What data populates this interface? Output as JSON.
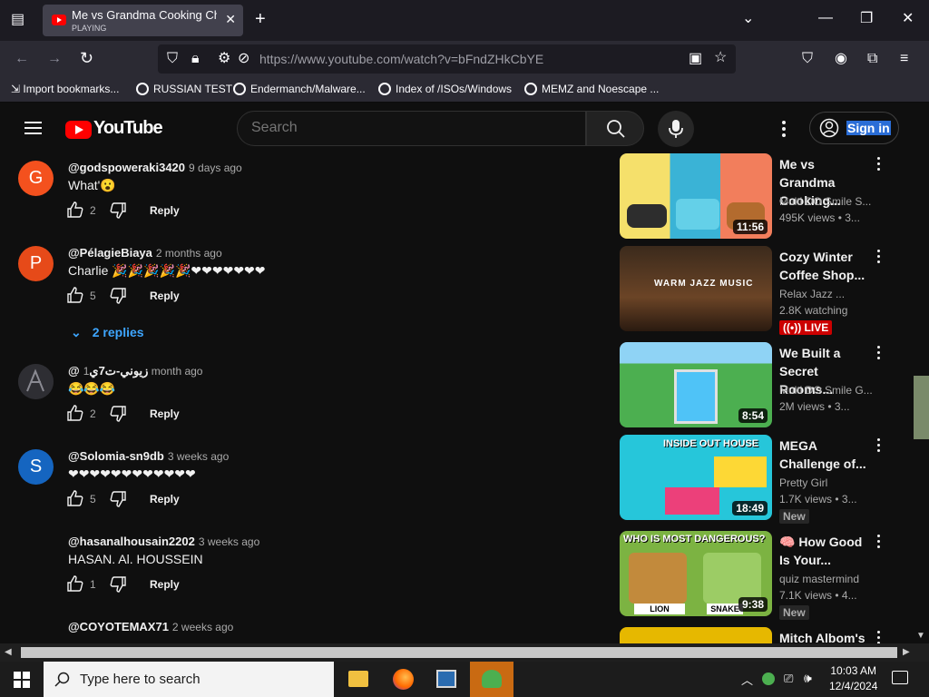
{
  "browser": {
    "tab_title": "Me vs Grandma Cooking Challenge",
    "tab_status": "PLAYING",
    "url": "https://www.youtube.com/watch?v=bFndZHkCbYE",
    "bookmarks": [
      "Import bookmarks...",
      "RUSSIAN TEST",
      "Endermanch/Malware...",
      "Index of /ISOs/Windows",
      "MEMZ and Noescape ..."
    ]
  },
  "youtube": {
    "logo": "YouTube",
    "search_placeholder": "Search",
    "sign_in": "Sign in"
  },
  "comments": [
    {
      "initial": "G",
      "color": "#f4511e",
      "author": "@godspoweraki3420",
      "time": "9 days ago",
      "text": "What'😮",
      "likes": "2",
      "reply": "Reply"
    },
    {
      "initial": "P",
      "color": "#e64a19",
      "author": "@PélagieBiaya",
      "time": "2 months ago",
      "text": "Charlie 🎉🎉🎉🎉🎉❤❤❤❤❤❤❤",
      "likes": "5",
      "reply": "Reply"
    },
    {
      "initial": "",
      "color": "#3a3a3a",
      "author": "@زيوني-ت7ي",
      "time": "1 month ago",
      "text": "😂😂😂",
      "likes": "2",
      "reply": "Reply"
    },
    {
      "initial": "S",
      "color": "#1565c0",
      "author": "@Solomia-sn9db",
      "time": "3 weeks ago",
      "text": "❤❤❤❤❤❤❤❤❤❤❤❤",
      "likes": "5",
      "reply": "Reply"
    },
    {
      "initial": "",
      "color": "",
      "author": "@hasanalhousain2202",
      "time": "3 weeks ago",
      "text": "HASAN.  Al.  HOUSSEIN",
      "likes": "1",
      "reply": "Reply"
    },
    {
      "initial": "",
      "color": "",
      "author": "@COYOTEMAX71",
      "time": "2 weeks ago",
      "text": "",
      "likes": "",
      "reply": ""
    }
  ],
  "replies_toggle": "2 replies",
  "videos": [
    {
      "title": "Me vs Grandma Cooking...",
      "channel": "Multi DO Smile S...",
      "meta": "495K views • 3...",
      "duration": "11:56",
      "badge": "",
      "thumb_color": "#3ab3d6"
    },
    {
      "title": "Cozy Winter Coffee Shop...",
      "channel": "Relax Jazz ...",
      "meta": "2.8K watching",
      "duration": "",
      "badge": "LIVE",
      "thumb_color": "#3b2a1c",
      "thumb_text": "WARM JAZZ MUSIC"
    },
    {
      "title": "We Built a Secret Rooms...",
      "channel": "Multi DO Smile G...",
      "meta": "2M views • 3...",
      "duration": "8:54",
      "badge": "",
      "thumb_color": "#4caf50"
    },
    {
      "title": "MEGA Challenge of...",
      "channel": "Pretty Girl",
      "meta": "1.7K views • 3...",
      "duration": "18:49",
      "badge": "New",
      "thumb_color": "#26c6da",
      "thumb_text": "INSIDE OUT HOUSE"
    },
    {
      "title": "🧠 How Good Is Your...",
      "channel": "quiz mastermind",
      "meta": "7.1K views • 4...",
      "duration": "9:38",
      "badge": "New",
      "thumb_color": "#7cb342",
      "thumb_text": "WHO IS MOST DANGEROUS?",
      "thumb_labels": [
        "LION",
        "SNAKE"
      ]
    },
    {
      "title": "Mitch Albom's",
      "channel": "",
      "meta": "",
      "duration": "",
      "badge": "",
      "thumb_color": "#e6b800"
    }
  ],
  "taskbar": {
    "search_placeholder": "Type here to search",
    "time": "10:03 AM",
    "date": "12/4/2024"
  }
}
